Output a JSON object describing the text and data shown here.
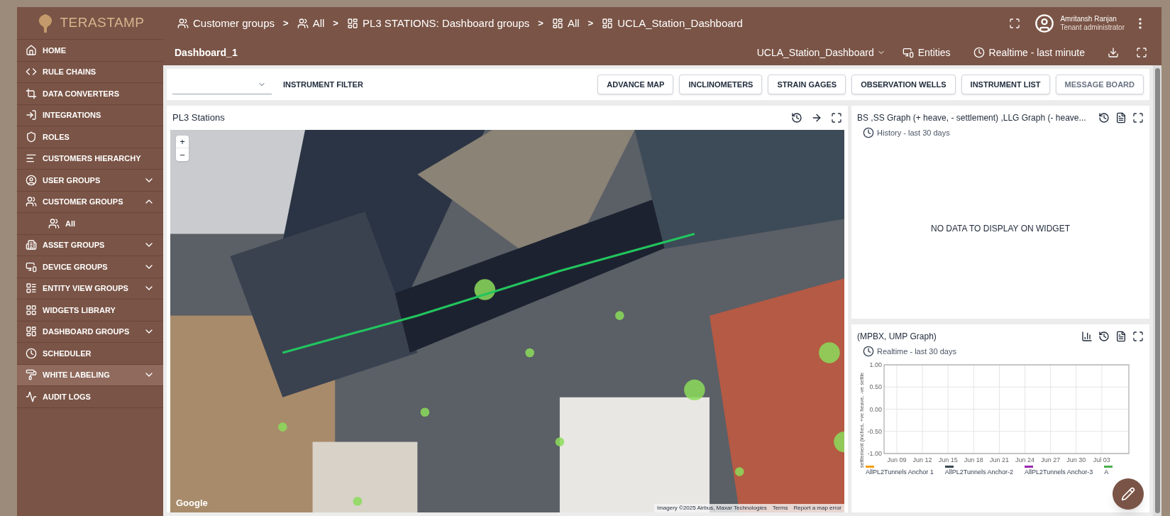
{
  "brand": "TERASTAMP",
  "breadcrumbs": [
    {
      "label": "Customer groups",
      "kind": "group"
    },
    {
      "label": "All",
      "kind": "group"
    },
    {
      "label": "PL3 STATIONS: Dashboard groups",
      "kind": "dashboard"
    },
    {
      "label": "All",
      "kind": "dashboard"
    },
    {
      "label": "UCLA_Station_Dashboard",
      "kind": "dashboard"
    }
  ],
  "breadcrumb_separator": ">",
  "user": {
    "name": "Amritansh Ranjan",
    "role": "Tenant administrator"
  },
  "sidebar": {
    "items": [
      {
        "label": "HOME",
        "selected": false
      },
      {
        "label": "RULE CHAINS",
        "selected": false
      },
      {
        "label": "DATA CONVERTERS",
        "selected": false
      },
      {
        "label": "INTEGRATIONS",
        "selected": false
      },
      {
        "label": "ROLES",
        "selected": false
      },
      {
        "label": "CUSTOMERS HIERARCHY",
        "selected": false
      },
      {
        "label": "USER GROUPS",
        "selected": false,
        "expanded": false
      },
      {
        "label": "CUSTOMER GROUPS",
        "selected": false,
        "expanded": true,
        "children": [
          {
            "label": "All",
            "selected": false
          }
        ]
      },
      {
        "label": "ASSET GROUPS",
        "selected": false,
        "expanded": false
      },
      {
        "label": "DEVICE GROUPS",
        "selected": false,
        "expanded": false
      },
      {
        "label": "ENTITY VIEW GROUPS",
        "selected": false,
        "expanded": false
      },
      {
        "label": "WIDGETS LIBRARY",
        "selected": false
      },
      {
        "label": "DASHBOARD GROUPS",
        "selected": false,
        "expanded": false
      },
      {
        "label": "SCHEDULER",
        "selected": false
      },
      {
        "label": "WHITE LABELING",
        "selected": true,
        "expanded": false
      },
      {
        "label": "AUDIT LOGS",
        "selected": false
      }
    ]
  },
  "toolbar": {
    "title": "Dashboard_1",
    "dashboard_select": "UCLA_Station_Dashboard",
    "entities": "Entities",
    "timewindow": "Realtime - last minute"
  },
  "filter": {
    "label": "INSTRUMENT FILTER",
    "buttons": [
      {
        "label": "ADVANCE MAP",
        "disabled": false
      },
      {
        "label": "INCLINOMETERS",
        "disabled": false
      },
      {
        "label": "STRAIN GAGES",
        "disabled": false
      },
      {
        "label": "OBSERVATION WELLS",
        "disabled": false
      },
      {
        "label": "INSTRUMENT LIST",
        "disabled": false
      },
      {
        "label": "MESSAGE BOARD",
        "disabled": true
      }
    ]
  },
  "map_widget": {
    "title": "PL3 Stations",
    "zoom_in": "+",
    "zoom_out": "−",
    "google": "Google",
    "attribution": "Imagery ©2025 Airbus, Maxar Technologies",
    "terms": "Terms",
    "report": "Report a map error"
  },
  "graph_widget": {
    "title": "BS ,SS Graph (+ heave, - settlement) ,LLG Graph (- heave...",
    "timewindow": "History - last 30 days",
    "empty_message": "NO DATA TO DISPLAY ON WIDGET"
  },
  "chart_widget": {
    "title": "(MPBX, UMP Graph)",
    "timewindow": "Realtime - last 30 days",
    "chart_data": {
      "type": "line",
      "grid": true,
      "ylabel": "settlement (inches, +ve heave, -ve settle",
      "ylim": [
        -1,
        1
      ],
      "yticks": [
        {
          "value": 1,
          "label": "1.00"
        },
        {
          "value": 0.5,
          "label": "0.50"
        },
        {
          "value": 0,
          "label": "0.00"
        },
        {
          "value": -0.5,
          "label": "-0.50"
        },
        {
          "value": -1,
          "label": "-1.00"
        }
      ],
      "categories": [
        "Jun 09",
        "Jun 12",
        "Jun 15",
        "Jun 18",
        "Jun 21",
        "Jun 24",
        "Jun 27",
        "Jun 30",
        "Jul 03"
      ],
      "series": [
        {
          "name": "AllPL2Tunnels Anchor 1",
          "color": "#f59e0b",
          "values": [
            null,
            null,
            null,
            null,
            null,
            null,
            null,
            null,
            null
          ]
        },
        {
          "name": "AllPL2Tunnels Anchor-2",
          "color": "#37474f",
          "values": [
            null,
            null,
            null,
            null,
            null,
            null,
            null,
            null,
            null
          ]
        },
        {
          "name": "AllPL2Tunnels Anchor-3",
          "color": "#9c27b0",
          "values": [
            null,
            null,
            null,
            null,
            null,
            null,
            null,
            null,
            null
          ]
        },
        {
          "name": "A",
          "color": "#4caf50",
          "values": [
            null,
            null,
            null,
            null,
            null,
            null,
            null,
            null,
            null
          ]
        }
      ]
    }
  }
}
